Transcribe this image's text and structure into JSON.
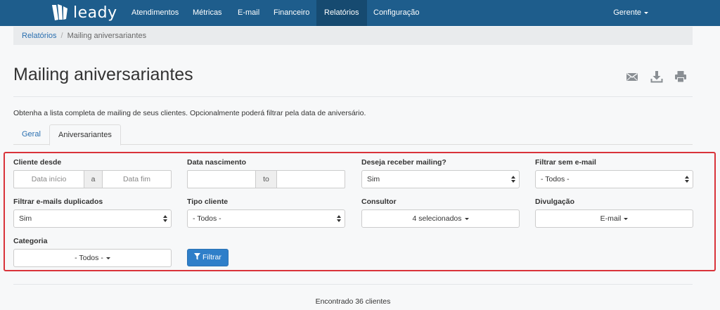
{
  "app": {
    "logo_text": "leady"
  },
  "nav": {
    "items": [
      {
        "label": "Atendimentos"
      },
      {
        "label": "Métricas"
      },
      {
        "label": "E-mail"
      },
      {
        "label": "Financeiro"
      },
      {
        "label": "Relatórios",
        "active": true
      },
      {
        "label": "Configuração"
      }
    ],
    "user_label": "Gerente"
  },
  "breadcrumb": {
    "parent": "Relatórios",
    "separator": "/",
    "current": "Mailing aniversariantes"
  },
  "page": {
    "title": "Mailing aniversariantes",
    "toolbar_icons": [
      "envelope-icon",
      "download-icon",
      "print-icon"
    ],
    "intro": "Obtenha a lista completa de mailing de seus clientes. Opcionalmente poderá filtrar pela data de aniversário."
  },
  "tabs": [
    {
      "label": "Geral",
      "active": false
    },
    {
      "label": "Aniversariantes",
      "active": true
    }
  ],
  "filters": {
    "cliente_desde": {
      "label": "Cliente desde",
      "start_placeholder": "Data início",
      "joiner": "a",
      "end_placeholder": "Data fim"
    },
    "data_nascimento": {
      "label": "Data nascimento",
      "start_value": "",
      "joiner": "to",
      "end_value": ""
    },
    "deseja_mailing": {
      "label": "Deseja receber mailing?",
      "value": "Sim"
    },
    "filtrar_sem_email": {
      "label": "Filtrar sem e-mail",
      "value": "- Todos -"
    },
    "filtrar_duplicados": {
      "label": "Filtrar e-mails duplicados",
      "value": "Sim"
    },
    "tipo_cliente": {
      "label": "Tipo cliente",
      "value": "- Todos -"
    },
    "consultor": {
      "label": "Consultor",
      "value": "4 selecionados"
    },
    "divulgacao": {
      "label": "Divulgação",
      "value": "E-mail"
    },
    "categoria": {
      "label": "Categoria",
      "value": "- Todos -"
    },
    "submit_label": "Filtrar"
  },
  "result_text": "Encontrado 36 clientes",
  "colors": {
    "navbar": "#1e5d8c",
    "nav_active": "#164a70",
    "primary": "#2f7fc9",
    "highlight_border": "#d9333a",
    "link": "#2a6fb0"
  }
}
